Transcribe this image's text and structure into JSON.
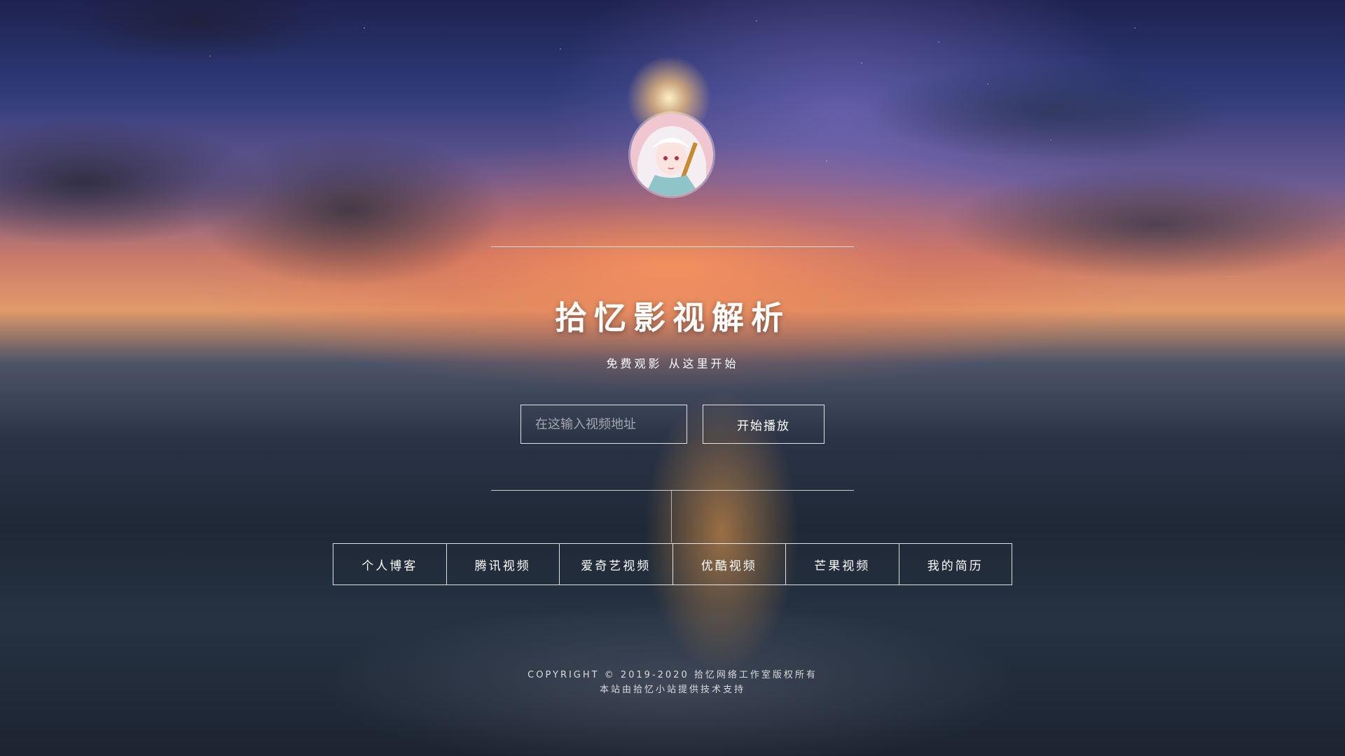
{
  "site": {
    "title": "拾忆影视解析",
    "subtitle": "免费观影 从这里开始"
  },
  "player": {
    "url_placeholder": "在这输入视频地址",
    "url_value": "",
    "play_label": "开始播放"
  },
  "nav": {
    "items": [
      {
        "label": "个人博客"
      },
      {
        "label": "腾讯视频"
      },
      {
        "label": "爱奇艺视频"
      },
      {
        "label": "优酷视频"
      },
      {
        "label": "芒果视频"
      },
      {
        "label": "我的简历"
      }
    ]
  },
  "footer": {
    "copyright": "COPYRIGHT © 2019-2020 拾忆网络工作室版权所有",
    "support": "本站由拾忆小站提供技术支持"
  },
  "colors": {
    "sky_top": "#1e2250",
    "sunset": "#e29a6a",
    "ground": "#1f2836",
    "line": "#ffffff"
  }
}
